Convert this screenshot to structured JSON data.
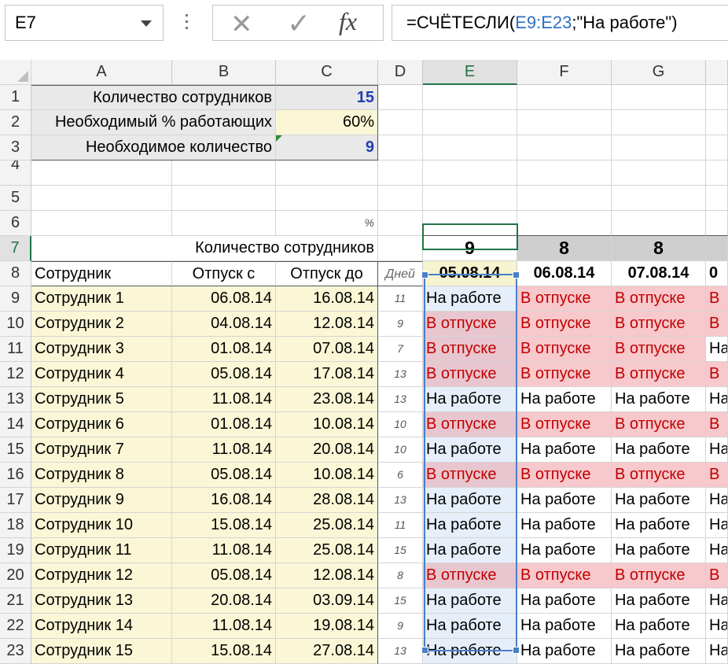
{
  "name_box": {
    "value": "E7"
  },
  "formula_bar": {
    "prefix": "=СЧЁТЕСЛИ(",
    "range_ref": "E9:E23",
    "suffix": ";\"На работе\")"
  },
  "columns": [
    "A",
    "B",
    "C",
    "D",
    "E",
    "F",
    "G"
  ],
  "rows": [
    "1",
    "2",
    "3",
    "4",
    "5",
    "6",
    "7",
    "8",
    "9",
    "10",
    "11",
    "12",
    "13",
    "14",
    "15",
    "16",
    "17",
    "18",
    "19",
    "20",
    "21",
    "22",
    "23"
  ],
  "summary": {
    "employees_label": "Количество сотрудников",
    "employees_value": "15",
    "percent_label": "Необходимый % работающих",
    "percent_value": "60%",
    "required_label": "Необходимое количество",
    "required_value": "9",
    "percent_sign": "%"
  },
  "row7": {
    "label": "Количество сотрудников",
    "e": "9",
    "f": "8",
    "g": "8"
  },
  "table_header": {
    "employee": "Сотрудник",
    "from": "Отпуск с",
    "to": "Отпуск до",
    "days": "Дней",
    "dates": [
      "05.08.14",
      "06.08.14",
      "07.08.14",
      "0"
    ]
  },
  "employees": [
    {
      "name": "Сотрудник 1",
      "from": "06.08.14",
      "to": "16.08.14",
      "days": "11",
      "e": "На работе",
      "f": "В отпуске",
      "g": "В отпуске",
      "h": "В"
    },
    {
      "name": "Сотрудник 2",
      "from": "04.08.14",
      "to": "12.08.14",
      "days": "9",
      "e": "В отпуске",
      "f": "В отпуске",
      "g": "В отпуске",
      "h": "В"
    },
    {
      "name": "Сотрудник 3",
      "from": "01.08.14",
      "to": "07.08.14",
      "days": "7",
      "e": "В отпуске",
      "f": "В отпуске",
      "g": "В отпуске",
      "h": "На"
    },
    {
      "name": "Сотрудник 4",
      "from": "05.08.14",
      "to": "17.08.14",
      "days": "13",
      "e": "В отпуске",
      "f": "В отпуске",
      "g": "В отпуске",
      "h": "В"
    },
    {
      "name": "Сотрудник 5",
      "from": "11.08.14",
      "to": "23.08.14",
      "days": "13",
      "e": "На работе",
      "f": "На работе",
      "g": "На работе",
      "h": "На"
    },
    {
      "name": "Сотрудник 6",
      "from": "01.08.14",
      "to": "10.08.14",
      "days": "10",
      "e": "В отпуске",
      "f": "В отпуске",
      "g": "В отпуске",
      "h": "В"
    },
    {
      "name": "Сотрудник 7",
      "from": "11.08.14",
      "to": "20.08.14",
      "days": "10",
      "e": "На работе",
      "f": "На работе",
      "g": "На работе",
      "h": "На"
    },
    {
      "name": "Сотрудник 8",
      "from": "05.08.14",
      "to": "10.08.14",
      "days": "6",
      "e": "В отпуске",
      "f": "В отпуске",
      "g": "В отпуске",
      "h": "В"
    },
    {
      "name": "Сотрудник 9",
      "from": "16.08.14",
      "to": "28.08.14",
      "days": "13",
      "e": "На работе",
      "f": "На работе",
      "g": "На работе",
      "h": "На"
    },
    {
      "name": "Сотрудник 10",
      "from": "15.08.14",
      "to": "25.08.14",
      "days": "11",
      "e": "На работе",
      "f": "На работе",
      "g": "На работе",
      "h": "На"
    },
    {
      "name": "Сотрудник 11",
      "from": "11.08.14",
      "to": "25.08.14",
      "days": "15",
      "e": "На работе",
      "f": "На работе",
      "g": "На работе",
      "h": "На"
    },
    {
      "name": "Сотрудник 12",
      "from": "05.08.14",
      "to": "12.08.14",
      "days": "8",
      "e": "В отпуске",
      "f": "В отпуске",
      "g": "В отпуске",
      "h": "В"
    },
    {
      "name": "Сотрудник 13",
      "from": "20.08.14",
      "to": "03.09.14",
      "days": "15",
      "e": "На работе",
      "f": "На работе",
      "g": "На работе",
      "h": "На"
    },
    {
      "name": "Сотрудник 14",
      "from": "11.08.14",
      "to": "19.08.14",
      "days": "9",
      "e": "На работе",
      "f": "На работе",
      "g": "На работе",
      "h": "На"
    },
    {
      "name": "Сотрудник 15",
      "from": "15.08.14",
      "to": "27.08.14",
      "days": "13",
      "e": "На работе",
      "f": "На работе",
      "g": "На работе",
      "h": "На"
    }
  ],
  "status_values": {
    "vacation": "В отпуске",
    "working": "На работе"
  },
  "colors": {
    "vacation_fill": "#f7c8cc",
    "vacation_text": "#c00000",
    "input_fill": "#fbf7d6",
    "selection": "#217346",
    "range_outline": "#4a7fc9"
  }
}
